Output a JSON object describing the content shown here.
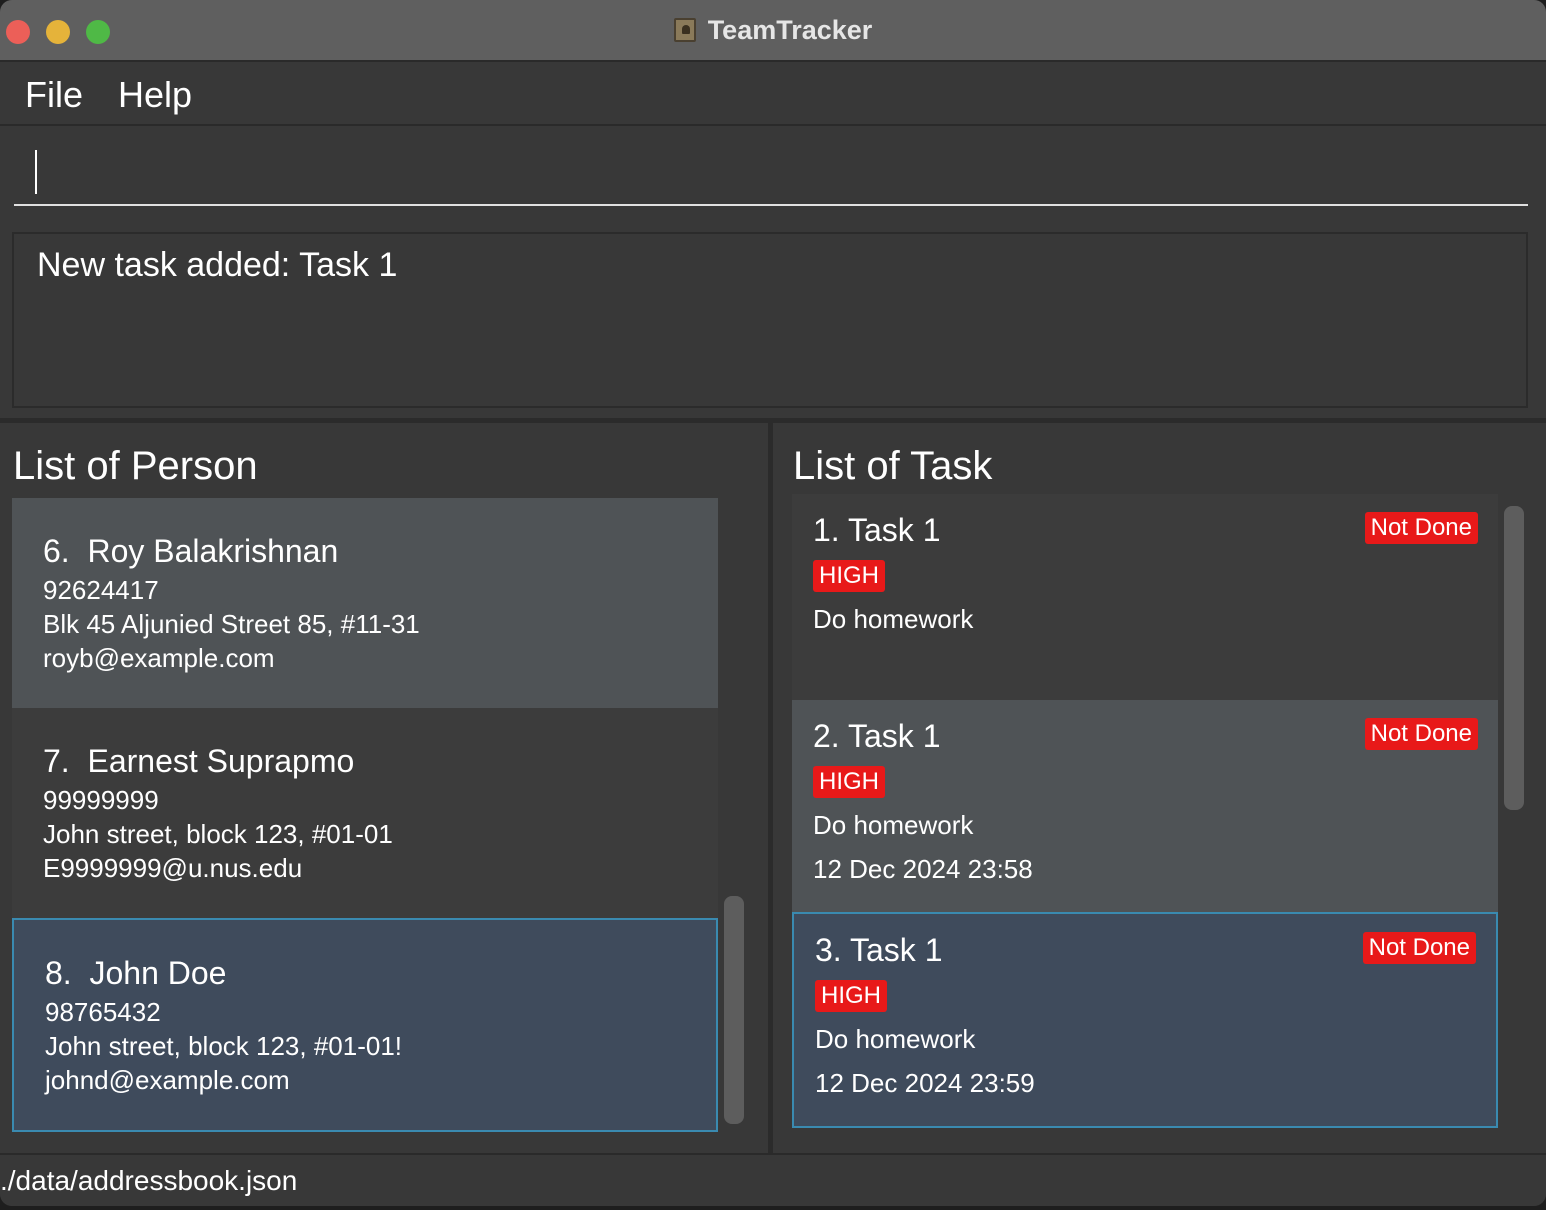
{
  "window": {
    "title": "TeamTracker"
  },
  "menu": {
    "file": "File",
    "help": "Help"
  },
  "command": {
    "value": ""
  },
  "result": {
    "message": "New task added: Task 1"
  },
  "persons_panel": {
    "title": "List of Person",
    "items": [
      {
        "index": "6.",
        "name": "Roy Balakrishnan",
        "phone": "92624417",
        "address": "Blk 45 Aljunied Street 85, #11-31",
        "email": "royb@example.com"
      },
      {
        "index": "7.",
        "name": "Earnest Suprapmo",
        "phone": "99999999",
        "address": "John street, block 123, #01-01",
        "email": "E9999999@u.nus.edu"
      },
      {
        "index": "8.",
        "name": "John Doe",
        "phone": "98765432",
        "address": "John street, block 123, #01-01!",
        "email": "johnd@example.com"
      }
    ]
  },
  "tasks_panel": {
    "title": "List of Task",
    "items": [
      {
        "title": "1. Task 1",
        "status": "Not Done",
        "priority": "HIGH",
        "description": "Do homework",
        "due": ""
      },
      {
        "title": "2. Task 1",
        "status": "Not Done",
        "priority": "HIGH",
        "description": "Do homework",
        "due": "12 Dec 2024 23:58"
      },
      {
        "title": "3. Task 1",
        "status": "Not Done",
        "priority": "HIGH",
        "description": "Do homework",
        "due": "12 Dec 2024 23:59"
      }
    ]
  },
  "statusbar": {
    "path": "./data/addressbook.json"
  },
  "colors": {
    "status_badge": "#e81919",
    "priority_badge": "#e81919",
    "selection_border": "#3a8ab0"
  }
}
